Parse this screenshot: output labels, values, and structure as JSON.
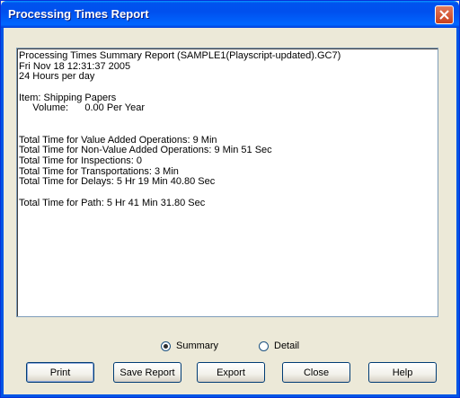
{
  "window": {
    "title": "Processing Times Report"
  },
  "report": {
    "lines": [
      "Processing Times Summary Report (SAMPLE1(Playscript-updated).GC7)",
      "Fri Nov 18 12:31:37 2005",
      "24 Hours per day",
      "",
      "Item: Shipping Papers",
      "     Volume:      0.00 Per Year",
      "",
      "",
      "Total Time for Value Added Operations: 9 Min",
      "Total Time for Non-Value Added Operations: 9 Min 51 Sec",
      "Total Time for Inspections: 0",
      "Total Time for Transportations: 3 Min",
      "Total Time for Delays: 5 Hr 19 Min 40.80 Sec",
      "",
      "Total Time for Path: 5 Hr 41 Min 31.80 Sec"
    ]
  },
  "view_options": {
    "summary_label": "Summary",
    "detail_label": "Detail",
    "selected": "Summary"
  },
  "buttons": {
    "print": "Print",
    "save_report": "Save Report",
    "export": "Export",
    "close": "Close",
    "help": "Help"
  },
  "icons": {
    "close": "close-icon",
    "radio_selected": "radio-selected-icon",
    "radio_unselected": "radio-unselected-icon"
  }
}
